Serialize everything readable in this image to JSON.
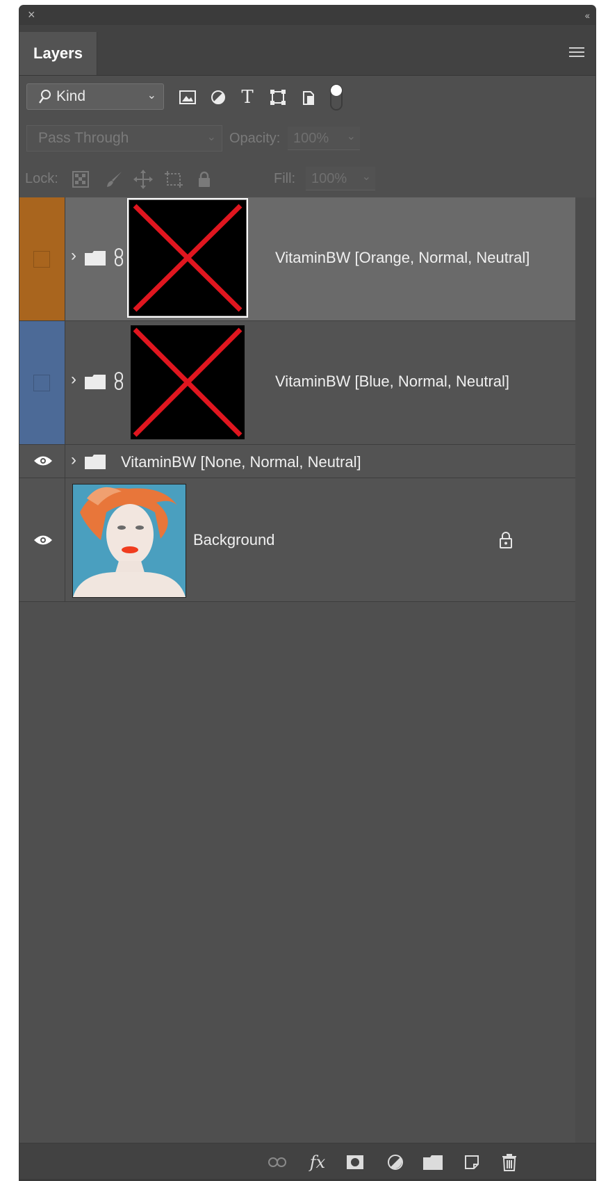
{
  "panel": {
    "tab_label": "Layers",
    "close_glyph": "×",
    "collapse_glyph": "‹‹"
  },
  "filter": {
    "kind_label": "Kind",
    "icons": [
      "image-filter-icon",
      "adjustment-filter-icon",
      "type-filter-icon",
      "shape-filter-icon",
      "smart-object-filter-icon",
      "filter-toggle-icon"
    ]
  },
  "blend": {
    "mode": "Pass Through",
    "opacity_label": "Opacity:",
    "opacity_value": "100%"
  },
  "lock": {
    "label": "Lock:",
    "fill_label": "Fill:",
    "fill_value": "100%"
  },
  "layers": [
    {
      "name": "VitaminBW [Orange, Normal, Neutral]",
      "color_tag": "#a9651e",
      "visible": false,
      "selected": true
    },
    {
      "name": "VitaminBW [Blue, Normal, Neutral]",
      "color_tag": "#4c6a97",
      "visible": false,
      "selected": false
    },
    {
      "name": "VitaminBW [None, Normal, Neutral]",
      "color_tag": "none",
      "visible": true,
      "selected": false
    },
    {
      "name": "Background",
      "color_tag": "none",
      "visible": true,
      "selected": false,
      "locked": true
    }
  ],
  "bottom_icons": [
    "link-layers-icon",
    "fx-icon",
    "add-mask-icon",
    "new-adjustment-icon",
    "new-group-icon",
    "new-layer-icon",
    "delete-layer-icon"
  ],
  "fx_label": "fx",
  "colors": {
    "panel_bg": "#4f4f4f",
    "selected_row": "#6a6a6a",
    "thumb_x": "#e0161f"
  }
}
